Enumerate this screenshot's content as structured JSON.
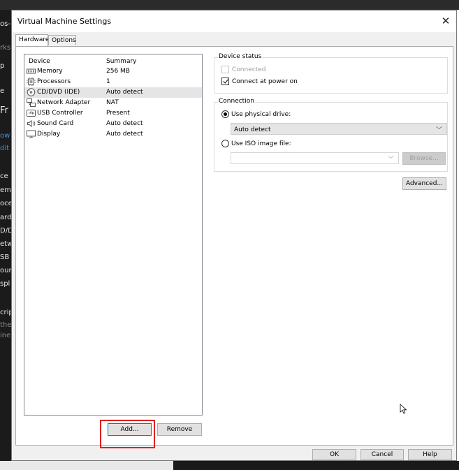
{
  "window": {
    "title": "Virtual Machine Settings"
  },
  "tabs": [
    {
      "label": "Hardware"
    },
    {
      "label": "Options"
    }
  ],
  "device_list": {
    "columns": {
      "device": "Device",
      "summary": "Summary"
    },
    "rows": [
      {
        "name": "Memory",
        "summary": "256 MB",
        "icon": "memory-icon"
      },
      {
        "name": "Processors",
        "summary": "1",
        "icon": "processor-icon"
      },
      {
        "name": "CD/DVD (IDE)",
        "summary": "Auto detect",
        "icon": "cd-dvd-icon"
      },
      {
        "name": "Network Adapter",
        "summary": "NAT",
        "icon": "network-adapter-icon"
      },
      {
        "name": "USB Controller",
        "summary": "Present",
        "icon": "usb-icon"
      },
      {
        "name": "Sound Card",
        "summary": "Auto detect",
        "icon": "speaker-icon"
      },
      {
        "name": "Display",
        "summary": "Auto detect",
        "icon": "display-icon"
      }
    ],
    "selected_index": 2
  },
  "buttons": {
    "add": "Add...",
    "remove": "Remove",
    "advanced": "Advanced...",
    "browse": "Browse...",
    "ok": "OK",
    "cancel": "Cancel",
    "help": "Help"
  },
  "device_status": {
    "label": "Device status",
    "connected": {
      "label": "Connected",
      "checked": false
    },
    "connect_at_power_on": {
      "label": "Connect at power on",
      "checked": true
    }
  },
  "connection": {
    "label": "Connection",
    "use_physical_drive": {
      "label": "Use physical drive:",
      "selected": true,
      "value": "Auto detect"
    },
    "use_iso_image": {
      "label": "Use ISO image file:",
      "selected": false,
      "value": ""
    }
  },
  "background": {
    "fragments": [
      "os-",
      "rks",
      "p",
      "e",
      "Fr",
      "ow",
      "dit",
      "ce",
      "em",
      "oce",
      "ard",
      "D/D",
      "etw",
      "SB",
      "oun",
      "spl",
      "crip",
      "the",
      "ine"
    ]
  },
  "colors": {
    "highlight": "#e02020",
    "selection": "#e5e5e5",
    "primary_border": "#0078d7"
  }
}
